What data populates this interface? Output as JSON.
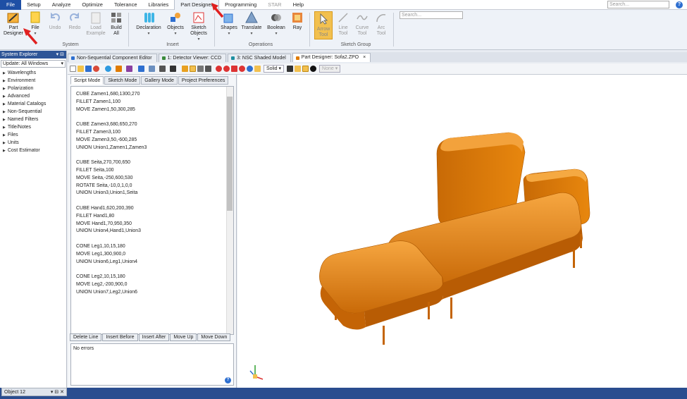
{
  "menubar": {
    "items": [
      {
        "label": "File",
        "kind": "file"
      },
      {
        "label": "Setup",
        "kind": ""
      },
      {
        "label": "Analyze",
        "kind": ""
      },
      {
        "label": "Optimize",
        "kind": ""
      },
      {
        "label": "Tolerance",
        "kind": ""
      },
      {
        "label": "Libraries",
        "kind": ""
      },
      {
        "label": "Part Designer",
        "kind": "active"
      },
      {
        "label": "Programming",
        "kind": ""
      },
      {
        "label": "STAR",
        "kind": "disabled"
      },
      {
        "label": "Help",
        "kind": ""
      }
    ],
    "search_placeholder": "Search...",
    "help_glyph": "?"
  },
  "ribbon": {
    "part_designer": "Part Designer",
    "file": "File",
    "undo": "Undo",
    "redo": "Redo",
    "load_example": "Load Example",
    "build_all": "Build All",
    "declaration": "Declaration",
    "objects": "Objects",
    "sketch_objects": "Sketch Objects",
    "shapes": "Shapes",
    "translate": "Translate",
    "boolean": "Boolean",
    "ray": "Ray",
    "arrow_tool": "Arrow Tool",
    "line_tool": "Line Tool",
    "curve_tool": "Curve Tool",
    "arc_tool": "Arc Tool",
    "search_placeholder": "Search...",
    "groups": {
      "system": "System",
      "insert": "Insert",
      "operations": "Operations",
      "sketch_group": "Sketch Group"
    }
  },
  "system_explorer": {
    "title": "System Explorer",
    "update": "Update: All Windows",
    "items": [
      "Wavelengths",
      "Environment",
      "Polarization",
      "Advanced",
      "Material Catalogs",
      "Non-Sequential",
      "Named Filters",
      "Title/Notes",
      "Files",
      "Units",
      "Cost Estimator"
    ]
  },
  "tabs": [
    {
      "label": "Non-Sequential Component Editor",
      "color": "#2e6fd0",
      "active": false
    },
    {
      "label": "1: Detector Viewer: CCD",
      "color": "#3a8a3a",
      "active": false
    },
    {
      "label": "3: NSC Shaded Model",
      "color": "#1d8ea0",
      "active": false
    },
    {
      "label": "Part Designer: Sofa2.ZPO",
      "color": "#e07b00",
      "active": true,
      "close": "×"
    }
  ],
  "doc_toolbar": {
    "render_mode": "Solid",
    "none_label": "None"
  },
  "script": {
    "mode_tabs": [
      "Script Mode",
      "Sketch Mode",
      "Gallery Mode",
      "Project Preferences"
    ],
    "lines": [
      "CUBE Zamen1,680,1300,270",
      "FILLET Zamen1,100",
      "MOVE Zamen1,50,300,285",
      "",
      "CUBE Zamen3,680,650,270",
      "FILLET Zamen3,100",
      "MOVE Zamen3,50,-600,285",
      "UNION Union1,Zamen1,Zamen3",
      "",
      "CUBE Seita,270,700,650",
      "FILLET Seita,100",
      "MOVE Seita,-250,600,530",
      "ROTATE Seita,-10,0,1,0,0",
      "UNION Union3,Union1,Seita",
      "",
      "CUBE Hand1,620,200,390",
      "FILLET Hand1,80",
      "MOVE Hand1,70,950,350",
      "UNION Union4,Hand1,Union3",
      "",
      "CONE Leg1,10,15,180",
      "MOVE Leg1,300,900,0",
      "UNION Union6,Leg1,Union4",
      "",
      "CONE Leg2,10,15,180",
      "MOVE Leg2,-200,900,0",
      "UNION Union7,Leg2,Union6"
    ],
    "buttons": [
      "Delete Line",
      "Insert Before",
      "Insert After",
      "Move Up",
      "Move Down"
    ],
    "errors": "No errors",
    "help_glyph": "?"
  },
  "object_tab": {
    "label": "Object 12",
    "controls": "▾ ⊟ ✕"
  },
  "colors": {
    "accent": "#2e5597",
    "menu_file": "#1e4fa5",
    "model_orange": "#e8860e",
    "status_bar": "#2a4d8f"
  }
}
